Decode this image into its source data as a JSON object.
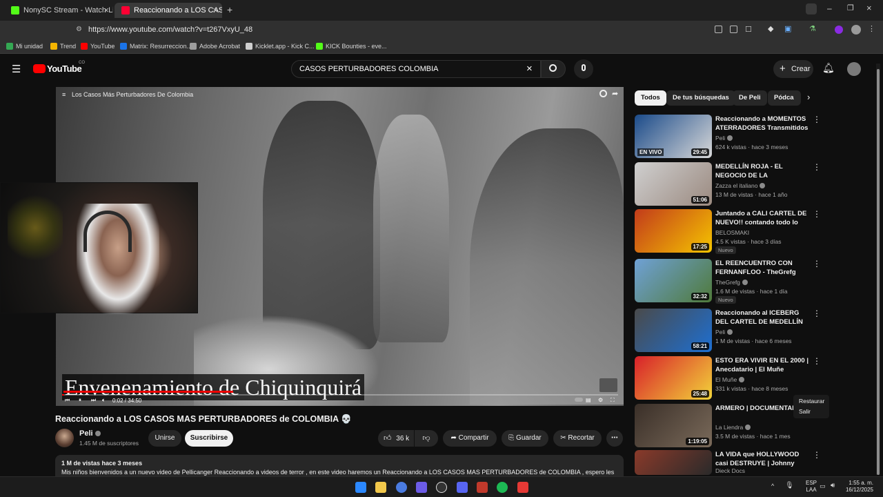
{
  "browser": {
    "tabs": [
      {
        "title": "NonySC Stream - Watch Live o",
        "favicon_color": "#53fc18"
      },
      {
        "title": "Reaccionando a LOS CASOS",
        "favicon_color": "#ff0033"
      }
    ],
    "new_tab_icon": "plus-icon",
    "url": "https://www.youtube.com/watch?v=t267VxyU_48",
    "bookmarks": [
      {
        "label": "Mi unidad",
        "color": "#34a853"
      },
      {
        "label": "Trend",
        "color": "#f4b400"
      },
      {
        "label": "YouTube",
        "color": "#ff0000"
      },
      {
        "label": "Matrix: Resurreccion...",
        "color": "#1a73e8"
      },
      {
        "label": "Adobe Acrobat",
        "color": "#9e9e9e"
      },
      {
        "label": "Kicklet.app - Kick C...",
        "color": "#cfcfcf"
      },
      {
        "label": "KICK Bounties - eve...",
        "color": "#53fc18"
      }
    ]
  },
  "youtube": {
    "logo_text": "YouTube",
    "logo_sup": "CO",
    "search_value": "CASOS PERTURBADORES COLOMBIA",
    "create_label": "Crear"
  },
  "player": {
    "overlay_title": "Los Casos Más Perturbadores De Colombia",
    "subtitle": "Envenenamiento de Chiquinquirá",
    "time": "0:02 / 34:50",
    "progress": 0.001
  },
  "video": {
    "title": "Reaccionando a LOS CASOS MAS PERTURBADORES de COLOMBIA 💀",
    "channel": "Peli",
    "subscribers": "1.45 M de suscriptores",
    "join_label": "Unirse",
    "subscribe_label": "Suscribirse",
    "likes": "36 k",
    "share_label": "Compartir",
    "save_label": "Guardar",
    "clip_label": "Recortar",
    "views_line": "1 M de vistas  hace 3 meses",
    "description": "Mis niños bienvenidos a un nuevo video de Pellicanger Reaccionando a videos de terror , en este video haremos un Reaccionando a LOS CASOS MAS PERTURBADORES de COLOMBIA , espero les"
  },
  "sidebar": {
    "chips": [
      "Todos",
      "De tus búsquedas",
      "De Peli",
      "Pódca"
    ],
    "videos": [
      {
        "title": "Reaccionando a MOMENTOS ATERRADORES Transmitidos ...",
        "channel": "Peli",
        "verified": true,
        "meta": "624 k vistas · hace 3 meses",
        "duration": "29:45",
        "live_label": "EN VIVO",
        "new": "",
        "thumb": [
          "#1b4b8a",
          "#d8d8d8"
        ]
      },
      {
        "title": "MEDELLÍN ROJA - EL NEGOCIO DE LA PROSTITUCIÓN co",
        "channel": "Zazza el italiano",
        "verified": true,
        "meta": "13 M de vistas · hace 1 año",
        "duration": "51:06",
        "live_label": "",
        "new": "",
        "thumb": [
          "#cfcfcf",
          "#9b8a80"
        ]
      },
      {
        "title": "Juntando a CALI CARTEL DE NUEVO!! contando todo lo que...",
        "channel": "BELOSMAKI",
        "verified": false,
        "meta": "4.5 K vistas · hace 3 días",
        "duration": "17:25",
        "live_label": "",
        "new": "Nuevo",
        "thumb": [
          "#c23b1b",
          "#f5c400"
        ]
      },
      {
        "title": "EL REENCUENTRO CON FERNANFLOO - TheGrefg",
        "channel": "TheGrefg",
        "verified": true,
        "meta": "1.6 M de vistas · hace 1 día",
        "duration": "32:32",
        "live_label": "",
        "new": "Nuevo",
        "thumb": [
          "#6fa1d6",
          "#4f7a3a"
        ]
      },
      {
        "title": "Reaccionando al ICEBERG DEL CARTEL DE MEDELLÍN",
        "channel": "Peli",
        "verified": true,
        "meta": "1 M de vistas · hace 6 meses",
        "duration": "58:21",
        "live_label": "",
        "new": "",
        "thumb": [
          "#4a4a4a",
          "#1e6fd1"
        ]
      },
      {
        "title": "ESTO ERA VIVIR EN EL 2000 | Anecdatario | El Muñe",
        "channel": "El Muñe",
        "verified": true,
        "meta": "331 k vistas · hace 8 meses",
        "duration": "25:48",
        "live_label": "",
        "new": "",
        "thumb": [
          "#d8202a",
          "#f2d33a"
        ]
      },
      {
        "title": "ARMERO | DOCUMENTAL",
        "channel": "La Liendra",
        "verified": true,
        "meta": "3.5 M de vistas · hace 1 mes",
        "duration": "1:19:05",
        "live_label": "",
        "new": "",
        "thumb": [
          "#3a2f28",
          "#7a6a5a"
        ]
      },
      {
        "title": "LA VIDA que HOLLYWOOD casi DESTRUYE | Johnny Depp | ...",
        "channel": "Dieck Docs",
        "verified": false,
        "meta": "",
        "duration": "",
        "live_label": "",
        "new": "",
        "thumb": [
          "#8a3a2a",
          "#2a2a2a"
        ]
      }
    ],
    "context_menu": [
      "Restaurar",
      "Salir"
    ]
  },
  "taskbar": {
    "lang": "ESP",
    "lang2": "LAA",
    "time": "1:55 a. m.",
    "date": "16/12/2025"
  }
}
